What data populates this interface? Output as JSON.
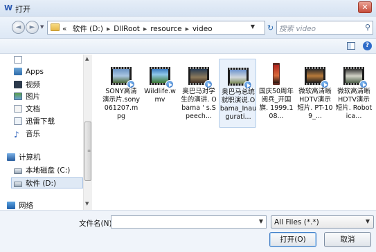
{
  "window": {
    "title": "打开",
    "app_icon": "W",
    "close_label": "✕"
  },
  "nav": {
    "back_icon": "◄",
    "forward_icon": "►",
    "recent_dropdown": "▼",
    "path_prefix": "«",
    "path": [
      "软件 (D:)",
      "DllRoot",
      "resource",
      "video"
    ],
    "path_sep": "▸",
    "address_dropdown": "▼",
    "refresh_icon": "↻",
    "search_placeholder": "搜索 video",
    "search_icon": "⚲"
  },
  "toolbar": {
    "help_label": "?"
  },
  "sidebar": {
    "items": [
      {
        "label": "",
        "icon": "doc-icon"
      },
      {
        "label": "Apps",
        "icon": "apps-icon"
      },
      {
        "label": "视频",
        "icon": "video-library-icon"
      },
      {
        "label": "图片",
        "icon": "pictures-icon"
      },
      {
        "label": "文档",
        "icon": "documents-icon"
      },
      {
        "label": "迅雷下载",
        "icon": "download-folder-icon"
      },
      {
        "label": "音乐",
        "icon": "music-icon"
      },
      {
        "label": "计算机",
        "icon": "computer-icon"
      },
      {
        "label": "本地磁盘 (C:)",
        "icon": "drive-icon"
      },
      {
        "label": "软件 (D:)",
        "icon": "drive-icon"
      },
      {
        "label": "网络",
        "icon": "network-icon"
      }
    ],
    "selected": "软件 (D:)",
    "scroll_up": "▲",
    "scroll_down": "▼",
    "scroll_grip": "≡"
  },
  "files": [
    {
      "name": "SONY高清演示片.sony061207.mpg",
      "thumb": "video-thumbnail",
      "selected": false
    },
    {
      "name": "Wildlife.wmv",
      "thumb": "video-thumbnail",
      "selected": false
    },
    {
      "name": "奥巴马对学生的演讲. Obama ' s.Speech...",
      "thumb": "video-thumbnail",
      "selected": false
    },
    {
      "name": "奥巴马总统就职演说.Obama_Inaugurati...",
      "thumb": "video-thumbnail",
      "selected": true
    },
    {
      "name": "国庆50周年阅兵_开国旗. 1999.108...",
      "thumb": "video-thumbnail-tall",
      "selected": false
    },
    {
      "name": "微软高清晰HDTV演示短片. PT-109_...",
      "thumb": "video-thumbnail",
      "selected": false
    },
    {
      "name": "微软高清晰HDTV演示短片. Robotica...",
      "thumb": "video-thumbnail",
      "selected": false
    }
  ],
  "bottom": {
    "filename_label": "文件名(N):",
    "filename_value": "",
    "filename_dropdown": "▼",
    "filter_value": "All Files (*.*)",
    "filter_dropdown": "▼",
    "open_label": "打开(O)",
    "cancel_label": "取消"
  }
}
